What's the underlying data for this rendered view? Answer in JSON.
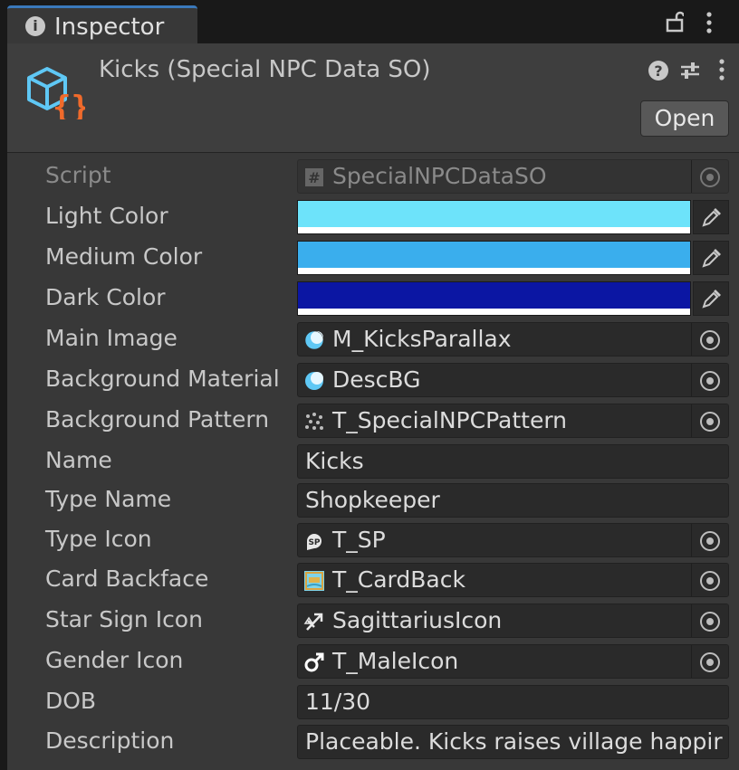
{
  "window": {
    "tab_title": "Inspector",
    "tab_icon": "info-icon",
    "lock_icon": "lock-icon",
    "menu_icon": "kebab-menu-icon"
  },
  "header": {
    "object_title": "Kicks (Special NPC Data SO)",
    "asset_icon": "scriptable-object-icon",
    "help_icon": "help-icon",
    "settings_icon": "preset-sliders-icon",
    "menu_icon": "kebab-menu-icon",
    "open_button": "Open"
  },
  "fields": {
    "script": {
      "label": "Script",
      "value": "SpecialNPCDataSO",
      "icon": "csharp-script-icon",
      "disabled": true
    },
    "light_color": {
      "label": "Light Color",
      "color": "#6de3fa"
    },
    "medium_color": {
      "label": "Medium Color",
      "color": "#3aaeed"
    },
    "dark_color": {
      "label": "Dark Color",
      "color": "#0b16a3"
    },
    "main_image": {
      "label": "Main Image",
      "value": "M_KicksParallax",
      "icon": "material-icon"
    },
    "background_material": {
      "label": "Background Material",
      "value": "DescBG",
      "icon": "material-icon"
    },
    "background_pattern": {
      "label": "Background Pattern",
      "value": "T_SpecialNPCPattern",
      "icon": "texture-icon"
    },
    "name": {
      "label": "Name",
      "value": "Kicks"
    },
    "type_name": {
      "label": "Type Name",
      "value": "Shopkeeper"
    },
    "type_icon": {
      "label": "Type Icon",
      "value": "T_SP",
      "icon": "sp-sprite-icon"
    },
    "card_backface": {
      "label": "Card Backface",
      "value": "T_CardBack",
      "icon": "card-texture-icon"
    },
    "star_sign_icon": {
      "label": "Star Sign Icon",
      "value": "SagittariusIcon",
      "icon": "sagittarius-icon"
    },
    "gender_icon": {
      "label": "Gender Icon",
      "value": "T_MaleIcon",
      "icon": "male-icon"
    },
    "dob": {
      "label": "DOB",
      "value": "11/30"
    },
    "description": {
      "label": "Description",
      "value": "Placeable. Kicks raises village happir"
    }
  },
  "colors": {
    "accent": "#3a79bb",
    "panel": "#383838",
    "field": "#2a2a2a",
    "orange": "#f06a2b",
    "cyan": "#5fc8f5"
  }
}
